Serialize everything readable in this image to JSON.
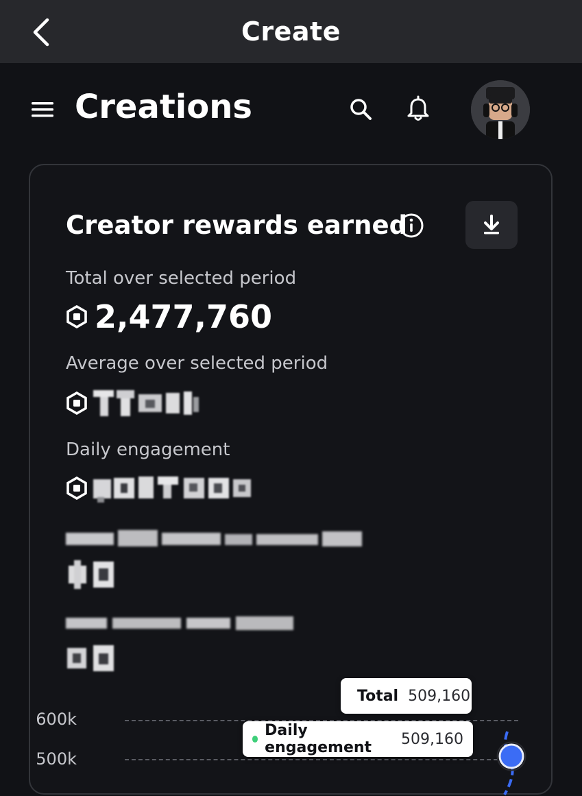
{
  "topbar": {
    "title": "Create"
  },
  "header": {
    "title": "Creations"
  },
  "card": {
    "title": "Creator rewards earned",
    "stats": [
      {
        "label": "Total over selected period",
        "value": "2,477,760"
      },
      {
        "label": "Average over selected period",
        "value": ""
      },
      {
        "label": "Daily engagement",
        "value": ""
      }
    ]
  },
  "chart_data": {
    "type": "line",
    "yticks": [
      "600k",
      "500k"
    ],
    "series": [
      {
        "name": "Total",
        "color": "#3b6cf5",
        "value": "509,160"
      },
      {
        "name": "Daily engagement",
        "color": "#3ecf7a",
        "value": "509,160"
      }
    ]
  },
  "colors": {
    "accent_blue": "#3b6cf5",
    "accent_green": "#3ecf7a"
  }
}
